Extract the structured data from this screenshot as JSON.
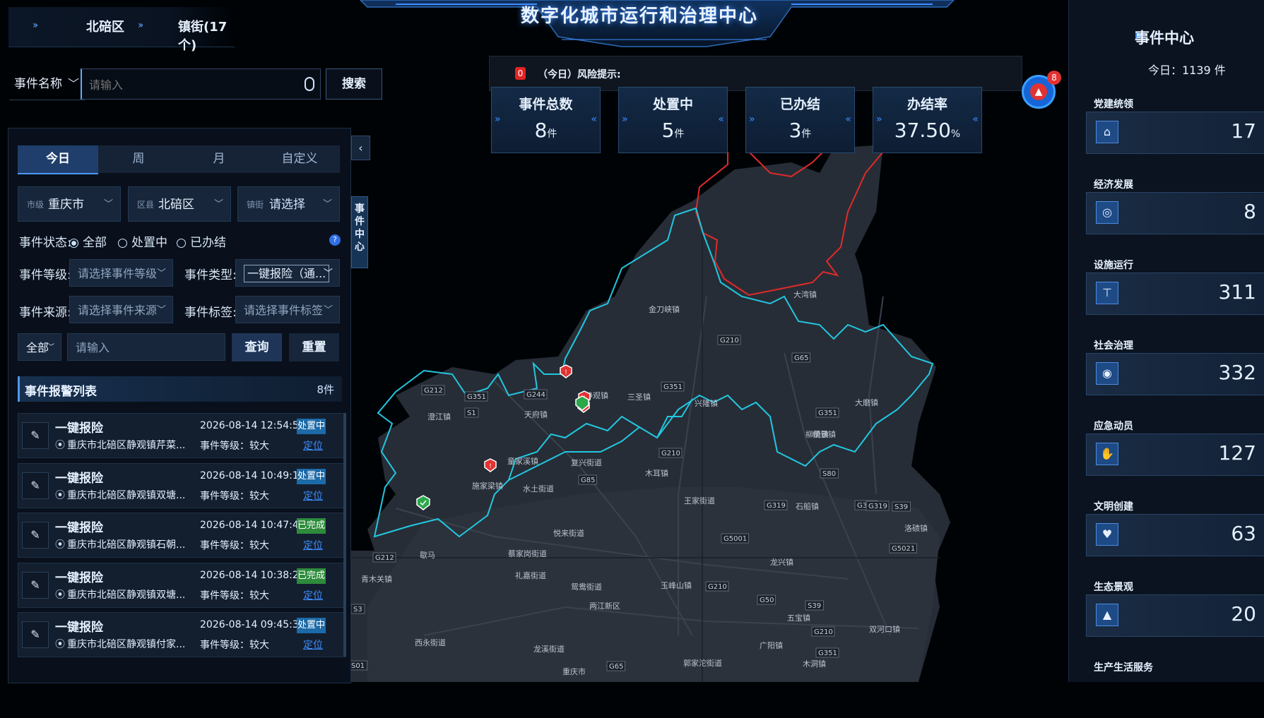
{
  "breadcrumb": {
    "district": "北碚区",
    "town": "镇街(17个)"
  },
  "search": {
    "field_label": "事件名称",
    "placeholder": "请输入",
    "button": "搜索"
  },
  "header": {
    "title": "数字化城市运行和治理中心"
  },
  "risk": {
    "icon_text": "0",
    "label": "（今日）风险提示:"
  },
  "stats": [
    {
      "label": "事件总数",
      "value": "8",
      "unit": "件"
    },
    {
      "label": "处置中",
      "value": "5",
      "unit": "件"
    },
    {
      "label": "已办结",
      "value": "3",
      "unit": "件"
    },
    {
      "label": "办结率",
      "value": "37.50",
      "unit": "%"
    }
  ],
  "alarm": {
    "badge": "8"
  },
  "left": {
    "tabs": [
      "今日",
      "周",
      "月",
      "自定义"
    ],
    "city": {
      "label": "市级",
      "value": "重庆市"
    },
    "district": {
      "label": "区县",
      "value": "北碚区"
    },
    "town": {
      "label": "镇街",
      "value": "请选择"
    },
    "status": {
      "label": "事件状态:",
      "options": [
        "全部",
        "处置中",
        "已办结"
      ]
    },
    "level": {
      "label": "事件等级:",
      "placeholder": "请选择事件等级"
    },
    "type": {
      "label": "事件类型:",
      "value": "一键报险（通..."
    },
    "source": {
      "label": "事件来源:",
      "placeholder": "请选择事件来源"
    },
    "tag": {
      "label": "事件标签:",
      "placeholder": "请选择事件标签"
    },
    "scope": "全部",
    "keyword_placeholder": "请输入",
    "query_btn": "查询",
    "reset_btn": "重置",
    "side_toggle": "‹",
    "side_tab": "事件中心",
    "list": {
      "title": "事件报警列表",
      "count": "8件",
      "items": [
        {
          "name": "一键报险",
          "addr": "重庆市北碚区静观镇芹菜...",
          "time": "2026-08-14 12:54:54",
          "level": "事件等级：较大",
          "status": "处置中",
          "loc": "定位"
        },
        {
          "name": "一键报险",
          "addr": "重庆市北碚区静观镇双塘...",
          "time": "2026-08-14 10:49:14",
          "level": "事件等级：较大",
          "status": "处置中",
          "loc": "定位"
        },
        {
          "name": "一键报险",
          "addr": "重庆市北碚区静观镇石朝...",
          "time": "2026-08-14 10:47:47",
          "level": "事件等级：较大",
          "status": "已完成",
          "loc": "定位"
        },
        {
          "name": "一键报险",
          "addr": "重庆市北碚区静观镇双塘...",
          "time": "2026-08-14 10:38:23",
          "level": "事件等级：较大",
          "status": "已完成",
          "loc": "定位"
        },
        {
          "name": "一键报险",
          "addr": "重庆市北碚区静观镇付家...",
          "time": "2026-08-14 09:45:32",
          "level": "事件等级：较大",
          "status": "处置中",
          "loc": "定位"
        }
      ]
    }
  },
  "right": {
    "title": "事件中心",
    "today": "今日：1139 件",
    "cards": [
      {
        "name": "党建统领",
        "value": "17",
        "icon": "building-icon"
      },
      {
        "name": "经济发展",
        "value": "8",
        "icon": "coins-icon"
      },
      {
        "name": "设施运行",
        "value": "311",
        "icon": "crane-icon"
      },
      {
        "name": "社会治理",
        "value": "332",
        "icon": "shield-eye-icon"
      },
      {
        "name": "应急动员",
        "value": "127",
        "icon": "hand-icon"
      },
      {
        "name": "文明创建",
        "value": "63",
        "icon": "heart-hands-icon"
      },
      {
        "name": "生态景观",
        "value": "20",
        "icon": "mountain-icon"
      },
      {
        "name": "生产生活服务",
        "value": "",
        "icon": "service-icon"
      }
    ]
  },
  "map": {
    "place_labels": [
      "金刀峡镇",
      "大湾镇",
      "三圣镇",
      "兴隆镇",
      "大磨镇",
      "柳荫镇",
      "静观镇",
      "天府镇",
      "澄江镇",
      "施家梁镇",
      "复兴街道",
      "水土街道",
      "木耳镇",
      "王家街道",
      "石船镇",
      "洛碛镇",
      "悦来街道",
      "龙兴镇",
      "礼嘉街道",
      "鸳鸯街道",
      "玉峰山镇",
      "两江新区",
      "五宝镇",
      "双河口镇",
      "西永街道",
      "龙溪街道",
      "郭家沱街道",
      "木洞镇",
      "重庆市",
      "歇马",
      "青木关镇",
      "蔡家岗街道",
      "广阳镇",
      "统景镇",
      "童家溪镇"
    ],
    "road_labels": [
      "G212",
      "G351",
      "G244",
      "G210",
      "G65",
      "G351",
      "S1",
      "G351",
      "G85",
      "G210",
      "S80",
      "G319",
      "G319",
      "S39",
      "G5001",
      "G5021",
      "G212",
      "G210",
      "G50",
      "S39",
      "G210",
      "G65",
      "G351",
      "S3",
      "S01",
      "G319"
    ],
    "incident_markers": 5,
    "safe_markers": 2
  }
}
